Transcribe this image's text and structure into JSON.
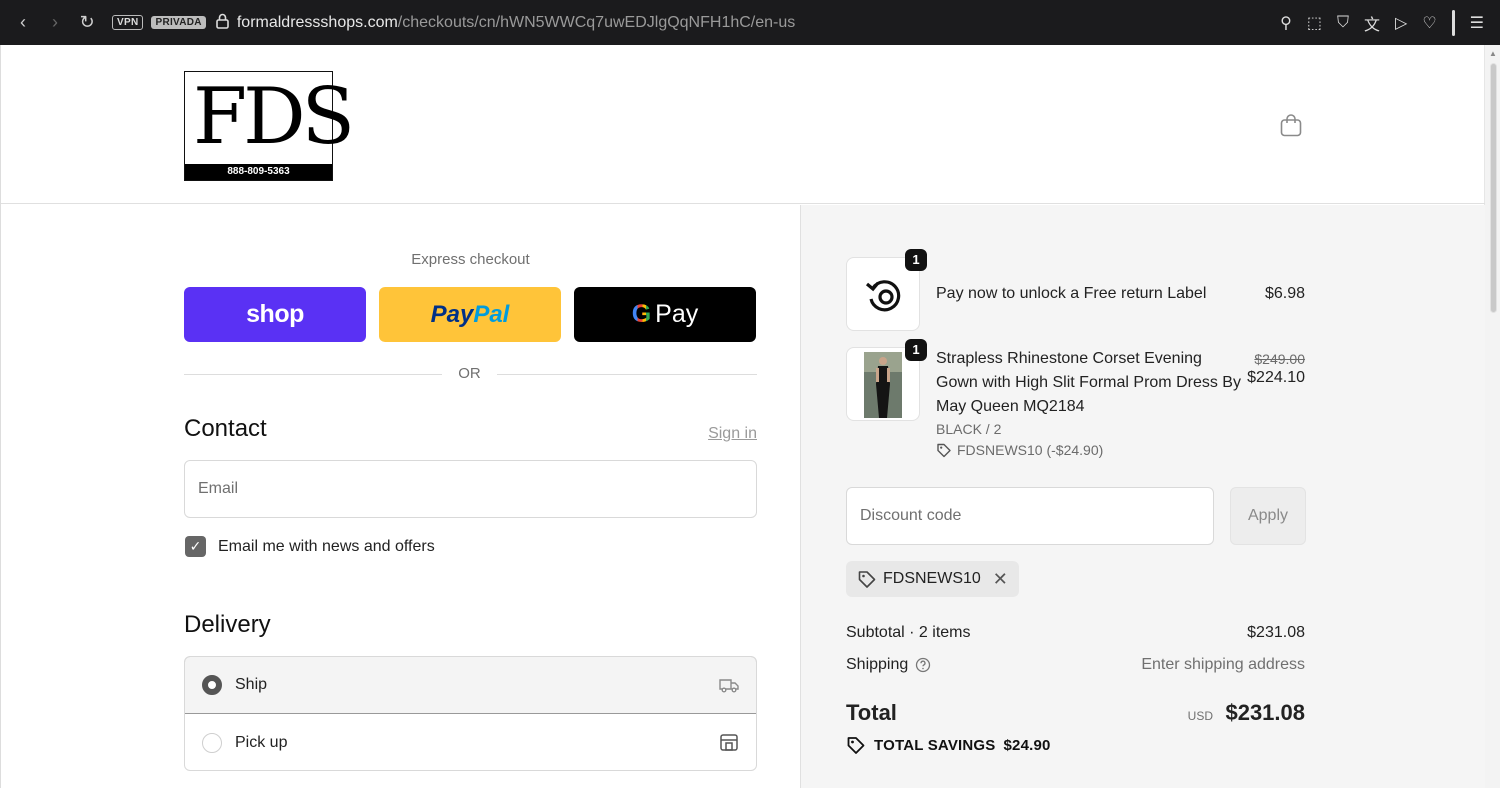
{
  "browser": {
    "vpn_badge": "VPN",
    "private_badge": "PRIVADA",
    "url_domain": "formaldressshops.com",
    "url_path": "/checkouts/cn/hWN5WWCq7uwEDJlgQqNFH1hC/en-us"
  },
  "header": {
    "logo_text": "FDS",
    "logo_phone": "888-809-5363"
  },
  "express": {
    "title": "Express checkout",
    "shop_label": "shop",
    "paypal_part1": "Pay",
    "paypal_part2": "Pal",
    "gpay_g": "G",
    "gpay_label": "Pay",
    "or_label": "OR"
  },
  "contact": {
    "heading": "Contact",
    "sign_in": "Sign in",
    "email_placeholder": "Email",
    "newsletter_label": "Email me with news and offers",
    "newsletter_checked": true
  },
  "delivery": {
    "heading": "Delivery",
    "options": [
      {
        "label": "Ship",
        "selected": true
      },
      {
        "label": "Pick up",
        "selected": false
      }
    ]
  },
  "summary": {
    "items": [
      {
        "qty": "1",
        "name": "Pay now to unlock a Free return Label",
        "price": "$6.98"
      },
      {
        "qty": "1",
        "name_line1": "Strapless Rhinestone Corset Evening",
        "name_line2": "Gown with High Slit Formal Prom Dress By",
        "name_line3": "May Queen MQ2184",
        "variant": "BLACK / 2",
        "discount": "FDSNEWS10 (-$24.90)",
        "original_price": "$249.00",
        "price": "$224.10"
      }
    ],
    "discount_placeholder": "Discount code",
    "apply_label": "Apply",
    "applied_code": "FDSNEWS10",
    "subtotal_label": "Subtotal · 2 items",
    "subtotal_value": "$231.08",
    "shipping_label": "Shipping",
    "shipping_value": "Enter shipping address",
    "total_label": "Total",
    "currency": "USD",
    "total_value": "$231.08",
    "savings_label": "TOTAL SAVINGS",
    "savings_value": "$24.90"
  },
  "colors": {
    "shop_pay": "#5a31f4",
    "paypal": "#ffc439",
    "gpay": "#000000",
    "summary_bg": "#f5f5f5"
  }
}
